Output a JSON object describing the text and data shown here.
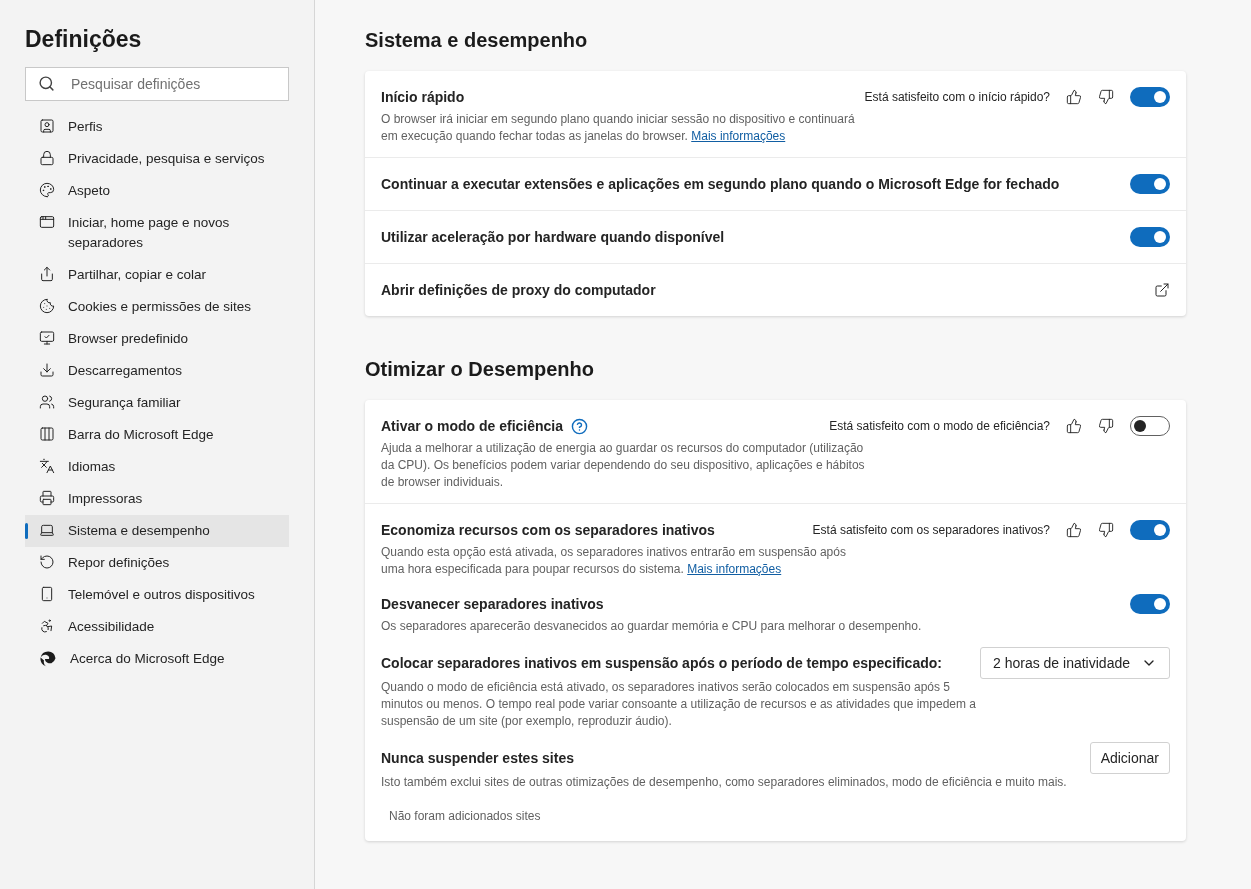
{
  "sidebar": {
    "title": "Definições",
    "search": {
      "placeholder": "Pesquisar definições"
    },
    "items": [
      {
        "label": "Perfis",
        "selected": false
      },
      {
        "label": "Privacidade, pesquisa e serviços",
        "selected": false
      },
      {
        "label": "Aspeto",
        "selected": false
      },
      {
        "label": "Iniciar, home page e novos separadores",
        "selected": false
      },
      {
        "label": "Partilhar, copiar e colar",
        "selected": false
      },
      {
        "label": "Cookies e permissões de sites",
        "selected": false
      },
      {
        "label": "Browser predefinido",
        "selected": false
      },
      {
        "label": "Descarregamentos",
        "selected": false
      },
      {
        "label": "Segurança familiar",
        "selected": false
      },
      {
        "label": "Barra do Microsoft Edge",
        "selected": false
      },
      {
        "label": "Idiomas",
        "selected": false
      },
      {
        "label": "Impressoras",
        "selected": false
      },
      {
        "label": "Sistema e desempenho",
        "selected": true
      },
      {
        "label": "Repor definições",
        "selected": false
      },
      {
        "label": "Telemóvel e outros dispositivos",
        "selected": false
      },
      {
        "label": "Acessibilidade",
        "selected": false
      },
      {
        "label": "Acerca do Microsoft Edge",
        "selected": false
      }
    ]
  },
  "sections": [
    {
      "title": "Sistema e desempenho",
      "groups": [
        [
          {
            "kind": "toggle",
            "title": "Início rápido",
            "feedback": "Está satisfeito com o início rápido?",
            "on": true,
            "description": "O browser irá iniciar em segundo plano quando iniciar sessão no dispositivo e continuará em execução quando fechar todas as janelas do browser.",
            "link": "Mais informações"
          }
        ],
        [
          {
            "kind": "toggle",
            "title": "Continuar a executar extensões e aplicações em segundo plano quando o Microsoft Edge for fechado",
            "on": true
          }
        ],
        [
          {
            "kind": "toggle",
            "title": "Utilizar aceleração por hardware quando disponível",
            "on": true
          }
        ],
        [
          {
            "kind": "external",
            "title": "Abrir definições de proxy do computador"
          }
        ]
      ]
    },
    {
      "title": "Otimizar o Desempenho",
      "groups": [
        [
          {
            "kind": "toggle",
            "title": "Ativar o modo de eficiência",
            "help": true,
            "feedback": "Está satisfeito com o modo de eficiência?",
            "on": false,
            "description": "Ajuda a melhorar a utilização de energia ao guardar os recursos do computador (utilização da CPU). Os benefícios podem variar dependendo do seu dispositivo, aplicações e hábitos de browser individuais."
          }
        ],
        [
          {
            "kind": "toggle",
            "title": "Economiza recursos com os separadores inativos",
            "feedback": "Está satisfeito com os separadores inativos?",
            "on": true,
            "description": "Quando esta opção está ativada, os separadores inativos entrarão em suspensão após uma hora especificada para poupar recursos do sistema.",
            "link": "Mais informações"
          },
          {
            "kind": "toggle",
            "title": "Desvanecer separadores inativos",
            "on": true,
            "description": "Os separadores aparecerão desvanecidos ao guardar memória e CPU para melhorar o desempenho."
          },
          {
            "kind": "select",
            "title": "Colocar separadores inativos em suspensão após o período de tempo especificado:",
            "value": "2 horas de inatividade",
            "description": "Quando o modo de eficiência está ativado, os separadores inativos serão colocados em suspensão após 5 minutos ou menos. O tempo real pode variar consoante a utilização de recursos e as atividades que impedem a suspensão de um site (por exemplo, reproduzir áudio)."
          },
          {
            "kind": "sitelist",
            "title": "Nunca suspender estes sites",
            "button": "Adicionar",
            "description": "Isto também exclui sites de outras otimizações de desempenho, como separadores eliminados, modo de eficiência e muito mais.",
            "empty": "Não foram adicionados sites"
          }
        ]
      ]
    }
  ]
}
